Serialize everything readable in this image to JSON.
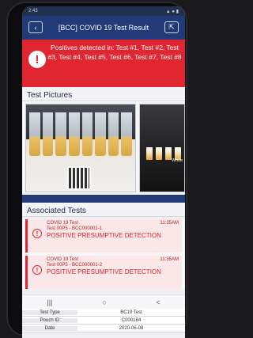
{
  "status_bar": {
    "time": "2:43"
  },
  "header": {
    "title": "[BCC] COVID 19 Test Result",
    "back_icon": "back-icon",
    "share_icon": "share-icon"
  },
  "alert": {
    "icon": "!",
    "message": "Positives detected in: Test #1, Test #2, Test #3, Test #4, Test #5, Test #6, Test #7, Test #8",
    "color": "#e02630"
  },
  "pictures": {
    "heading": "Test Pictures",
    "second_overlay": "White"
  },
  "associated": {
    "heading": "Associated Tests",
    "items": [
      {
        "name": "COVID 19 Test",
        "time": "11:35AM",
        "id": "Test 00P5 - BCC000001-1",
        "result": "POSITIVE PRESUMPTIVE DETECTION"
      },
      {
        "name": "COVID 19 Test",
        "time": "11:35AM",
        "id": "Test 00P5 - BCC000001-2",
        "result": "POSITIVE PRESUMPTIVE DETECTION"
      }
    ]
  },
  "nav": {
    "recent": "|||",
    "home": "○",
    "back": "<"
  },
  "info": [
    {
      "key": "Test Type",
      "value": "BC19 Test"
    },
    {
      "key": "Pouch ID",
      "value": "C000184"
    },
    {
      "key": "Date",
      "value": "2020-06-08"
    }
  ],
  "colors": {
    "navy": "#213a78",
    "red": "#e02630"
  }
}
